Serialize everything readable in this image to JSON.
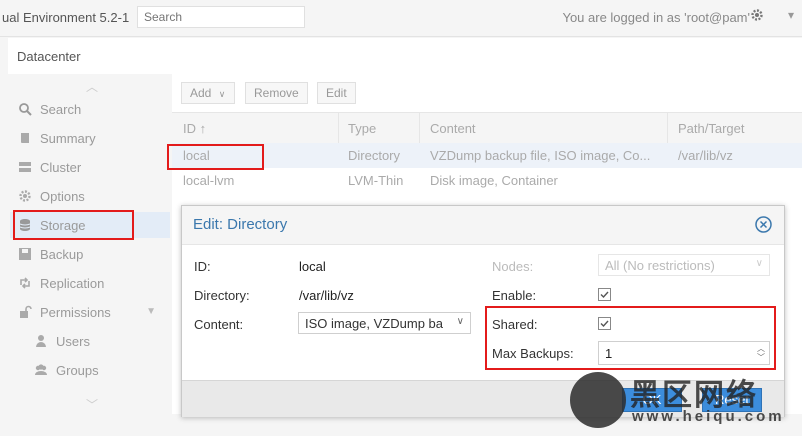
{
  "header": {
    "app_title": "ual Environment 5.2-1",
    "search_placeholder": "Search",
    "login_text": "You are logged in as 'root@pam'"
  },
  "datacenter": {
    "title": "Datacenter"
  },
  "sidebar": {
    "items": [
      {
        "label": "Search",
        "icon": "search-icon"
      },
      {
        "label": "Summary",
        "icon": "book-icon"
      },
      {
        "label": "Cluster",
        "icon": "server-icon"
      },
      {
        "label": "Options",
        "icon": "gear-icon"
      },
      {
        "label": "Storage",
        "icon": "database-icon",
        "active": true
      },
      {
        "label": "Backup",
        "icon": "floppy-icon"
      },
      {
        "label": "Replication",
        "icon": "retweet-icon"
      },
      {
        "label": "Permissions",
        "icon": "unlock-icon"
      },
      {
        "label": "Users",
        "icon": "user-icon"
      },
      {
        "label": "Groups",
        "icon": "users-icon"
      }
    ]
  },
  "toolbar": {
    "add_label": "Add",
    "remove_label": "Remove",
    "edit_label": "Edit"
  },
  "grid": {
    "columns": [
      "ID",
      "Type",
      "Content",
      "Path/Target"
    ],
    "sort_indicator": "↑",
    "rows": [
      {
        "id": "local",
        "type": "Directory",
        "content": "VZDump backup file, ISO image, Co...",
        "path": "/var/lib/vz"
      },
      {
        "id": "local-lvm",
        "type": "LVM-Thin",
        "content": "Disk image, Container",
        "path": ""
      }
    ]
  },
  "dialog": {
    "title": "Edit: Directory",
    "id_label": "ID:",
    "id_value": "local",
    "directory_label": "Directory:",
    "directory_value": "/var/lib/vz",
    "content_label": "Content:",
    "content_value": "ISO image, VZDump ba",
    "nodes_label": "Nodes:",
    "nodes_value": "All (No restrictions)",
    "enable_label": "Enable:",
    "enable_checked": true,
    "shared_label": "Shared:",
    "shared_checked": true,
    "max_backups_label": "Max Backups:",
    "max_backups_value": "1",
    "ok_label": "OK",
    "reset_label": "Reset"
  },
  "watermark": {
    "text": "黑区网络",
    "url": "www.heiqu.com"
  },
  "colors": {
    "accent": "#3b78ad",
    "highlight": "#e31b1b",
    "selection": "#edf2f9"
  }
}
